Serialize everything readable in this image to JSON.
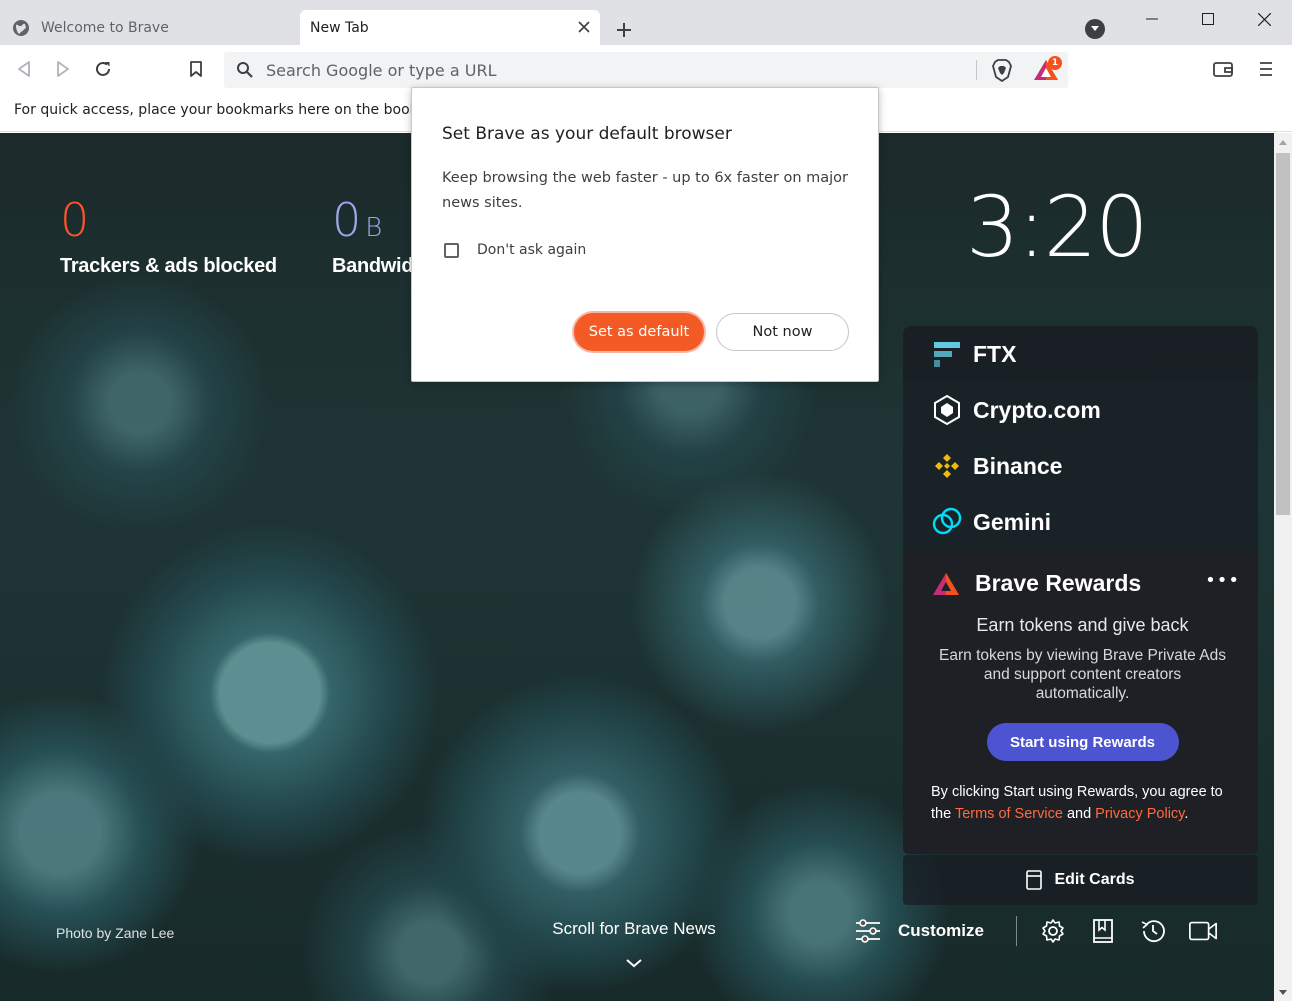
{
  "tabs": [
    {
      "label": "Welcome to Brave",
      "active": false
    },
    {
      "label": "New Tab",
      "active": true
    }
  ],
  "omnibox": {
    "placeholder": "Search Google or type a URL",
    "value": ""
  },
  "rewards_badge_count": "1",
  "bookmarks_bar": {
    "hint": "For quick access, place your bookmarks here on the bookmarks bar."
  },
  "stats": {
    "trackers": {
      "value": "0",
      "label": "Trackers & ads blocked",
      "color": "#fb542b"
    },
    "bandwidth": {
      "value": "0",
      "unit": "B",
      "label": "Bandwidth saved",
      "color": "#a0a5eb"
    }
  },
  "clock": "3:20",
  "widgets": {
    "tabs": [
      {
        "label": "FTX",
        "icon": "ftx-icon"
      },
      {
        "label": "Crypto.com",
        "icon": "crypto-com-icon"
      },
      {
        "label": "Binance",
        "icon": "binance-icon"
      },
      {
        "label": "Gemini",
        "icon": "gemini-icon"
      }
    ],
    "rewards": {
      "title": "Brave Rewards",
      "more": "•••",
      "subtitle": "Earn tokens and give back",
      "description": "Earn tokens by viewing Brave Private Ads and support content creators automatically.",
      "button": "Start using Rewards",
      "terms_prefix": "By clicking Start using Rewards, you agree to the ",
      "terms_link": "Terms of Service",
      "terms_and": " and ",
      "privacy_link": "Privacy Policy",
      "terms_suffix": "."
    },
    "edit_cards": "Edit Cards"
  },
  "footer": {
    "photo_credit": "Photo by Zane Lee",
    "scroll_news": "Scroll for Brave News",
    "customize": "Customize"
  },
  "dialog": {
    "title": "Set Brave as your default browser",
    "body": "Keep browsing the web faster - up to 6x faster on major news sites.",
    "checkbox_label": "Don't ask again",
    "checkbox_checked": false,
    "primary_button": "Set as default",
    "secondary_button": "Not now"
  },
  "colors": {
    "brave_orange": "#f45a25",
    "rewards_purple": "#4c54d2",
    "link_orange": "#ff6a3d"
  }
}
